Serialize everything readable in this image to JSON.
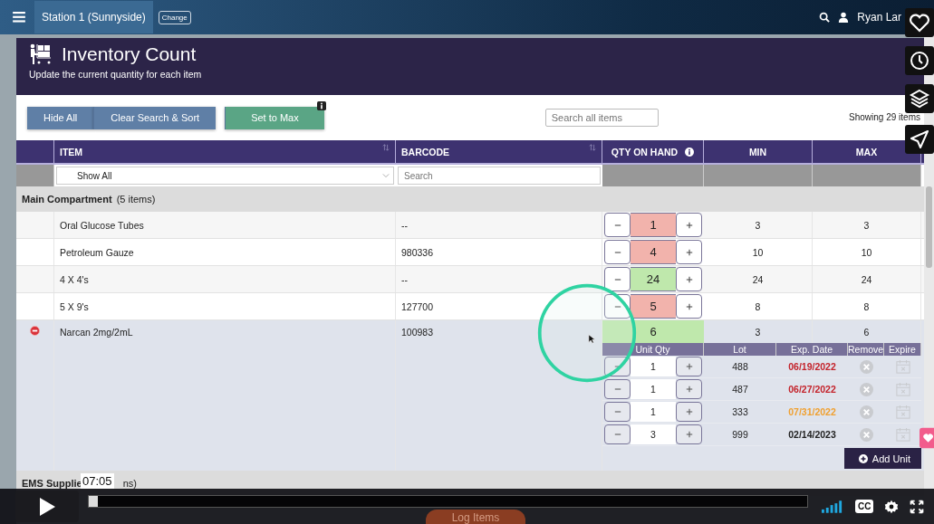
{
  "nav": {
    "location": "Station 1 (Sunnyside)",
    "change_button": "Change",
    "user": "Ryan Lar"
  },
  "header": {
    "title": "Inventory Count",
    "subtitle": "Update the current quantity for each item"
  },
  "toolbar": {
    "buttons": [
      {
        "label": "Hide All",
        "kind": "secondary",
        "info_badge": false
      },
      {
        "label": "Clear Search & Sort",
        "kind": "secondary",
        "info_badge": false
      },
      {
        "label": "Set to Max",
        "kind": "success",
        "info_badge": true
      }
    ],
    "search": {
      "placeholder": "Search all items"
    },
    "count": "Showing 29 items"
  },
  "table": {
    "columns": [
      {
        "label": "ITEM",
        "sortable": true,
        "info": false
      },
      {
        "label": "BARCODE",
        "sortable": true,
        "info": false
      },
      {
        "label": "QTY ON HAND",
        "sortable": false,
        "info": true
      },
      {
        "label": "MIN",
        "sortable": false,
        "info": false
      },
      {
        "label": "MAX",
        "sortable": false,
        "info": false
      }
    ],
    "filters": {
      "item_select": "Show All",
      "barcode_placeholder": "Search"
    },
    "groups": [
      {
        "name": "Main Compartment",
        "count": "(5 items)",
        "rows": [
          {
            "item": "Oral Glucose Tubes",
            "barcode": "--",
            "qty": "1",
            "below_min": true,
            "min": "3",
            "max": "3",
            "expanded": false
          },
          {
            "item": "Petroleum Gauze",
            "barcode": "980336",
            "qty": "4",
            "below_min": true,
            "min": "10",
            "max": "10",
            "expanded": false
          },
          {
            "item": "4 X 4's",
            "barcode": "--",
            "qty": "24",
            "below_min": false,
            "min": "24",
            "max": "24",
            "expanded": false
          },
          {
            "item": "5 X 9's",
            "barcode": "127700",
            "qty": "5",
            "below_min": true,
            "min": "8",
            "max": "8",
            "expanded": false
          },
          {
            "item": "Narcan 2mg/2mL",
            "barcode": "100983",
            "qty": "6",
            "below_min": false,
            "min": "3",
            "max": "6",
            "expanded": true,
            "units": {
              "columns": [
                "Unit Qty",
                "Lot",
                "Exp. Date",
                "Remove",
                "Expire"
              ],
              "rows": [
                {
                  "qty": "1",
                  "lot": "488",
                  "exp": "06/19/2022",
                  "color": "#c4232b"
                },
                {
                  "qty": "1",
                  "lot": "487",
                  "exp": "06/27/2022",
                  "color": "#c4232b"
                },
                {
                  "qty": "1",
                  "lot": "333",
                  "exp": "07/31/2022",
                  "color": "#f0a030"
                },
                {
                  "qty": "3",
                  "lot": "999",
                  "exp": "02/14/2023",
                  "color": "#222222"
                }
              ],
              "add_button": "Add Unit"
            }
          }
        ]
      },
      {
        "name": "EMS Supplie",
        "count": "ns)"
      }
    ]
  },
  "footer": {
    "log_button": "Log Items"
  },
  "video": {
    "time_tooltip": "07:05",
    "cc_label": "CC",
    "progress": {
      "level": 0.012
    }
  }
}
